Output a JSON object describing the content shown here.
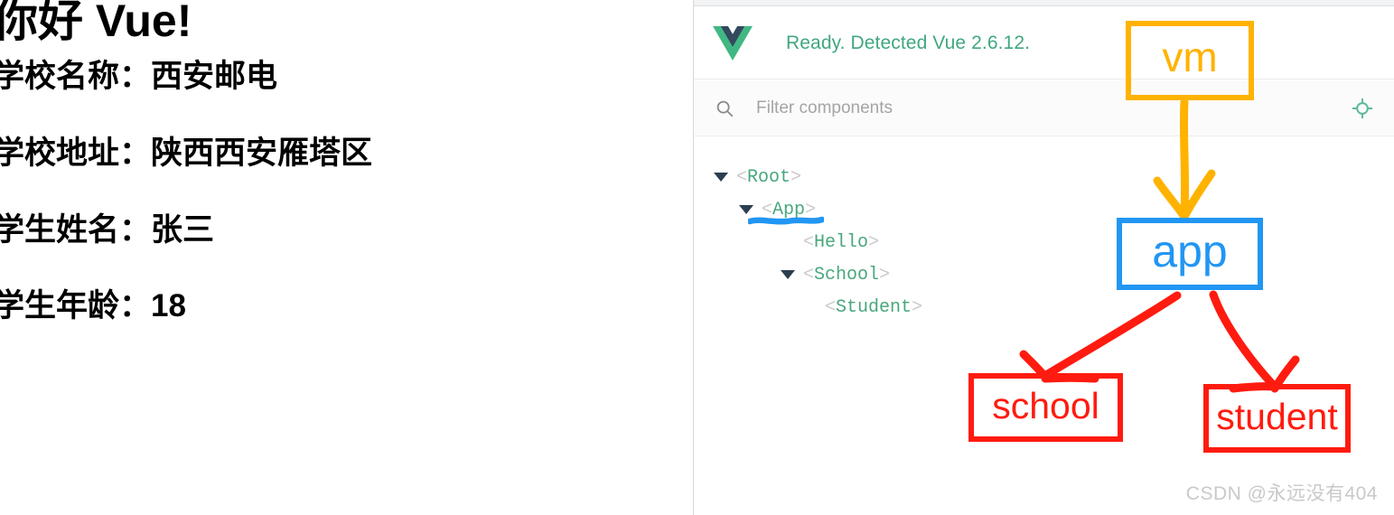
{
  "app_pane": {
    "heading": "你好 Vue!",
    "rows": [
      {
        "label": "学校名称：",
        "value": "西安邮电"
      },
      {
        "label": "学校地址：",
        "value": "陕西西安雁塔区"
      },
      {
        "label": "学生姓名：",
        "value": "张三"
      },
      {
        "label": "学生年龄：",
        "value": "18"
      }
    ]
  },
  "devtools": {
    "logo_icon": "vue-logo-icon",
    "status_text": "Ready. Detected Vue 2.6.12.",
    "status_color": "#41a77f",
    "filter": {
      "icon": "search-icon",
      "value": "",
      "placeholder": "Filter components"
    },
    "target_icon": "target-crosshair-icon",
    "target_icon_color": "#5cb89a",
    "tree": [
      {
        "name": "Root",
        "depth": 0,
        "expandable": true,
        "expanded": true,
        "selected": false
      },
      {
        "name": "App",
        "depth": 1,
        "expandable": true,
        "expanded": true,
        "selected": true
      },
      {
        "name": "Hello",
        "depth": 2,
        "expandable": false,
        "expanded": false,
        "selected": false
      },
      {
        "name": "School",
        "depth": 2,
        "expandable": true,
        "expanded": true,
        "selected": false
      },
      {
        "name": "Student",
        "depth": 3,
        "expandable": false,
        "expanded": false,
        "selected": false
      }
    ],
    "tag_open": "<",
    "tag_close": ">"
  },
  "annotations": {
    "vm": {
      "label": "vm",
      "color": "#FFB300"
    },
    "app": {
      "label": "app",
      "color": "#2196F3"
    },
    "school": {
      "label": "school",
      "color": "#FF1B0F"
    },
    "student": {
      "label": "student",
      "color": "#FF1B0F"
    },
    "app_underline_color": "#2196F3"
  },
  "watermark": "CSDN @永远没有404"
}
